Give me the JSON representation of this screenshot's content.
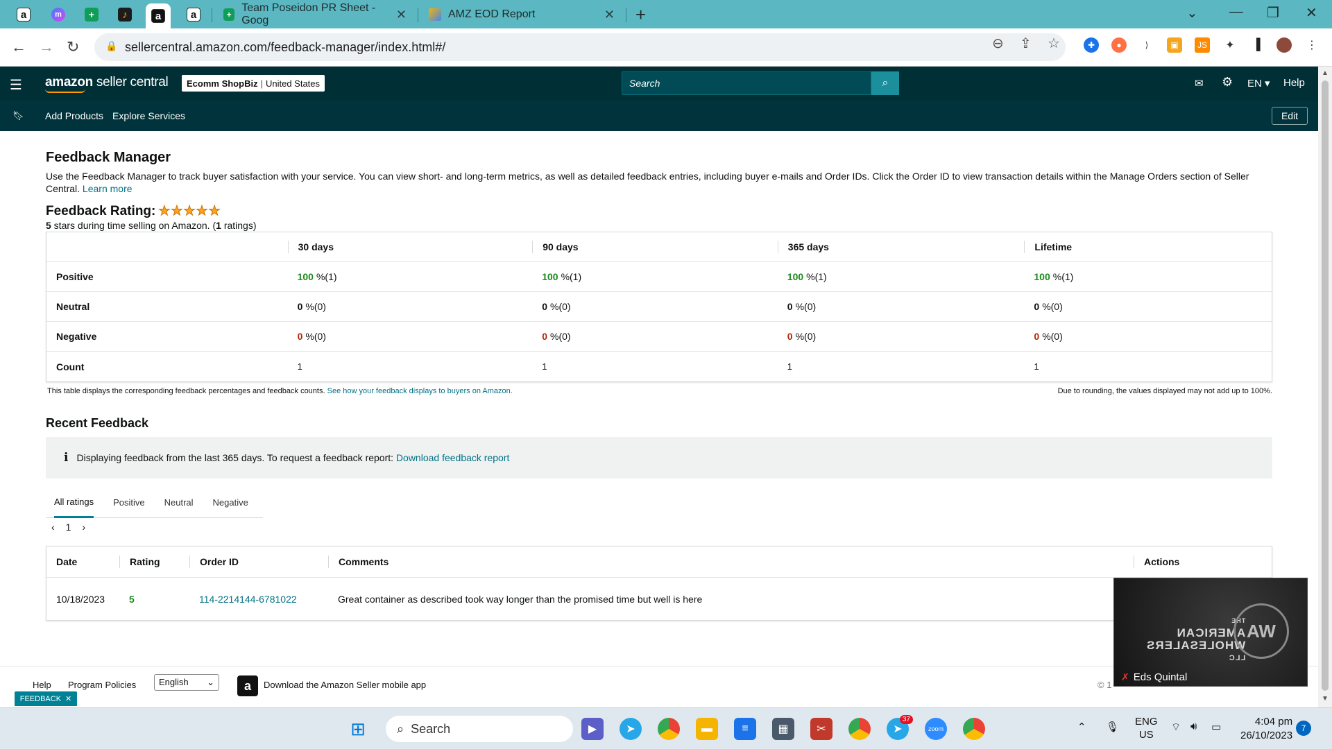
{
  "browser": {
    "pinned_tabs": [
      {
        "icon": "amazon-icon",
        "glyph": "a"
      },
      {
        "icon": "messenger-icon",
        "glyph": "m"
      },
      {
        "icon": "sheets-icon",
        "glyph": "+"
      },
      {
        "icon": "dark-app-icon",
        "glyph": "♪"
      },
      {
        "icon": "amazon-icon",
        "glyph": "a"
      },
      {
        "icon": "amazon-icon",
        "glyph": "a"
      }
    ],
    "tabs": [
      {
        "title": "Team Poseidon PR Sheet - Goog",
        "icon": "sheets-icon"
      },
      {
        "title": "AMZ EOD Report",
        "icon": "report-icon"
      }
    ],
    "url": "sellercentral.amazon.com/feedback-manager/index.html#/"
  },
  "header": {
    "logo_bold": "amazon",
    "logo_light": " seller central",
    "store_name": "Ecomm ShopBiz",
    "store_region": "United States",
    "search_placeholder": "Search",
    "lang": "EN",
    "help": "Help"
  },
  "subnav": {
    "items": [
      "Add Products",
      "Explore Services"
    ],
    "edit": "Edit"
  },
  "page": {
    "title": "Feedback Manager",
    "intro": "Use the Feedback Manager to track buyer satisfaction with your service. You can view short- and long-term metrics, as well as detailed feedback entries, including buyer e-mails and Order IDs. Click the Order ID to view transaction details within the Manage Orders section of Seller Central.",
    "learn_more": "Learn more",
    "rating_title": "Feedback Rating:",
    "rating_stars": 5,
    "rating_sub_value": "5",
    "rating_sub_text": " stars during time selling on Amazon. (",
    "rating_sub_count": "1",
    "rating_sub_end": " ratings)"
  },
  "feedback_table": {
    "columns": [
      "30 days",
      "90 days",
      "365 days",
      "Lifetime"
    ],
    "rows": [
      {
        "label": "Positive",
        "cells": [
          [
            "100",
            " %(1)"
          ],
          [
            "100",
            " %(1)"
          ],
          [
            "100",
            " %(1)"
          ],
          [
            "100",
            " %(1)"
          ]
        ]
      },
      {
        "label": "Neutral",
        "cells": [
          [
            "0",
            " %(0)"
          ],
          [
            "0",
            " %(0)"
          ],
          [
            "0",
            " %(0)"
          ],
          [
            "0",
            " %(0)"
          ]
        ]
      },
      {
        "label": "Negative",
        "cells": [
          [
            "0",
            " %(0)"
          ],
          [
            "0",
            " %(0)"
          ],
          [
            "0",
            " %(0)"
          ],
          [
            "0",
            " %(0)"
          ]
        ]
      },
      {
        "label": "Count",
        "cells": [
          [
            "1",
            ""
          ],
          [
            "1",
            ""
          ],
          [
            "1",
            ""
          ],
          [
            "1",
            ""
          ]
        ]
      }
    ],
    "note": "This table displays the corresponding feedback percentages and feedback counts.",
    "note_link": "See how your feedback displays to buyers on Amazon.",
    "rounding_note": "Due to rounding, the values displayed may not add up to 100%."
  },
  "recent": {
    "title": "Recent Feedback",
    "info": "Displaying feedback from the last 365 days. To request a feedback report:",
    "info_link": "Download feedback report",
    "tabs": [
      "All ratings",
      "Positive",
      "Neutral",
      "Negative"
    ],
    "active_tab": "All ratings",
    "page": "1",
    "headers": [
      "Date",
      "Rating",
      "Order ID",
      "Comments",
      "Actions"
    ],
    "rows": [
      {
        "date": "10/18/2023",
        "rating": "5",
        "order_id": "114-2214144-6781022",
        "comment": "Great container as described took way longer than the promised time but well is here"
      }
    ]
  },
  "footer": {
    "help": "Help",
    "policies": "Program Policies",
    "language": "English",
    "app_text": "Download the Amazon Seller mobile app",
    "feedback": "FEEDBACK",
    "copyright_fragment": "© 1"
  },
  "video": {
    "brand_line1": "THE",
    "brand_line2": "AMERICAN",
    "brand_line3": "WHOLESALERS",
    "brand_line4": "LLC",
    "emblem": "AW",
    "participant": "Eds Quintal"
  },
  "taskbar": {
    "search": "Search",
    "telegram_badge": "37",
    "lang_line1": "ENG",
    "lang_line2": "US",
    "time": "4:04 pm",
    "date": "26/10/2023",
    "notifications": "7"
  },
  "colors": {
    "tabstrip": "#5bb8c2",
    "header": "#002f36",
    "subnav": "#00333b",
    "teal_accent": "#008296",
    "positive": "#1b8a1b",
    "negative": "#b12704",
    "link": "#007185",
    "star": "#ffa41c"
  }
}
